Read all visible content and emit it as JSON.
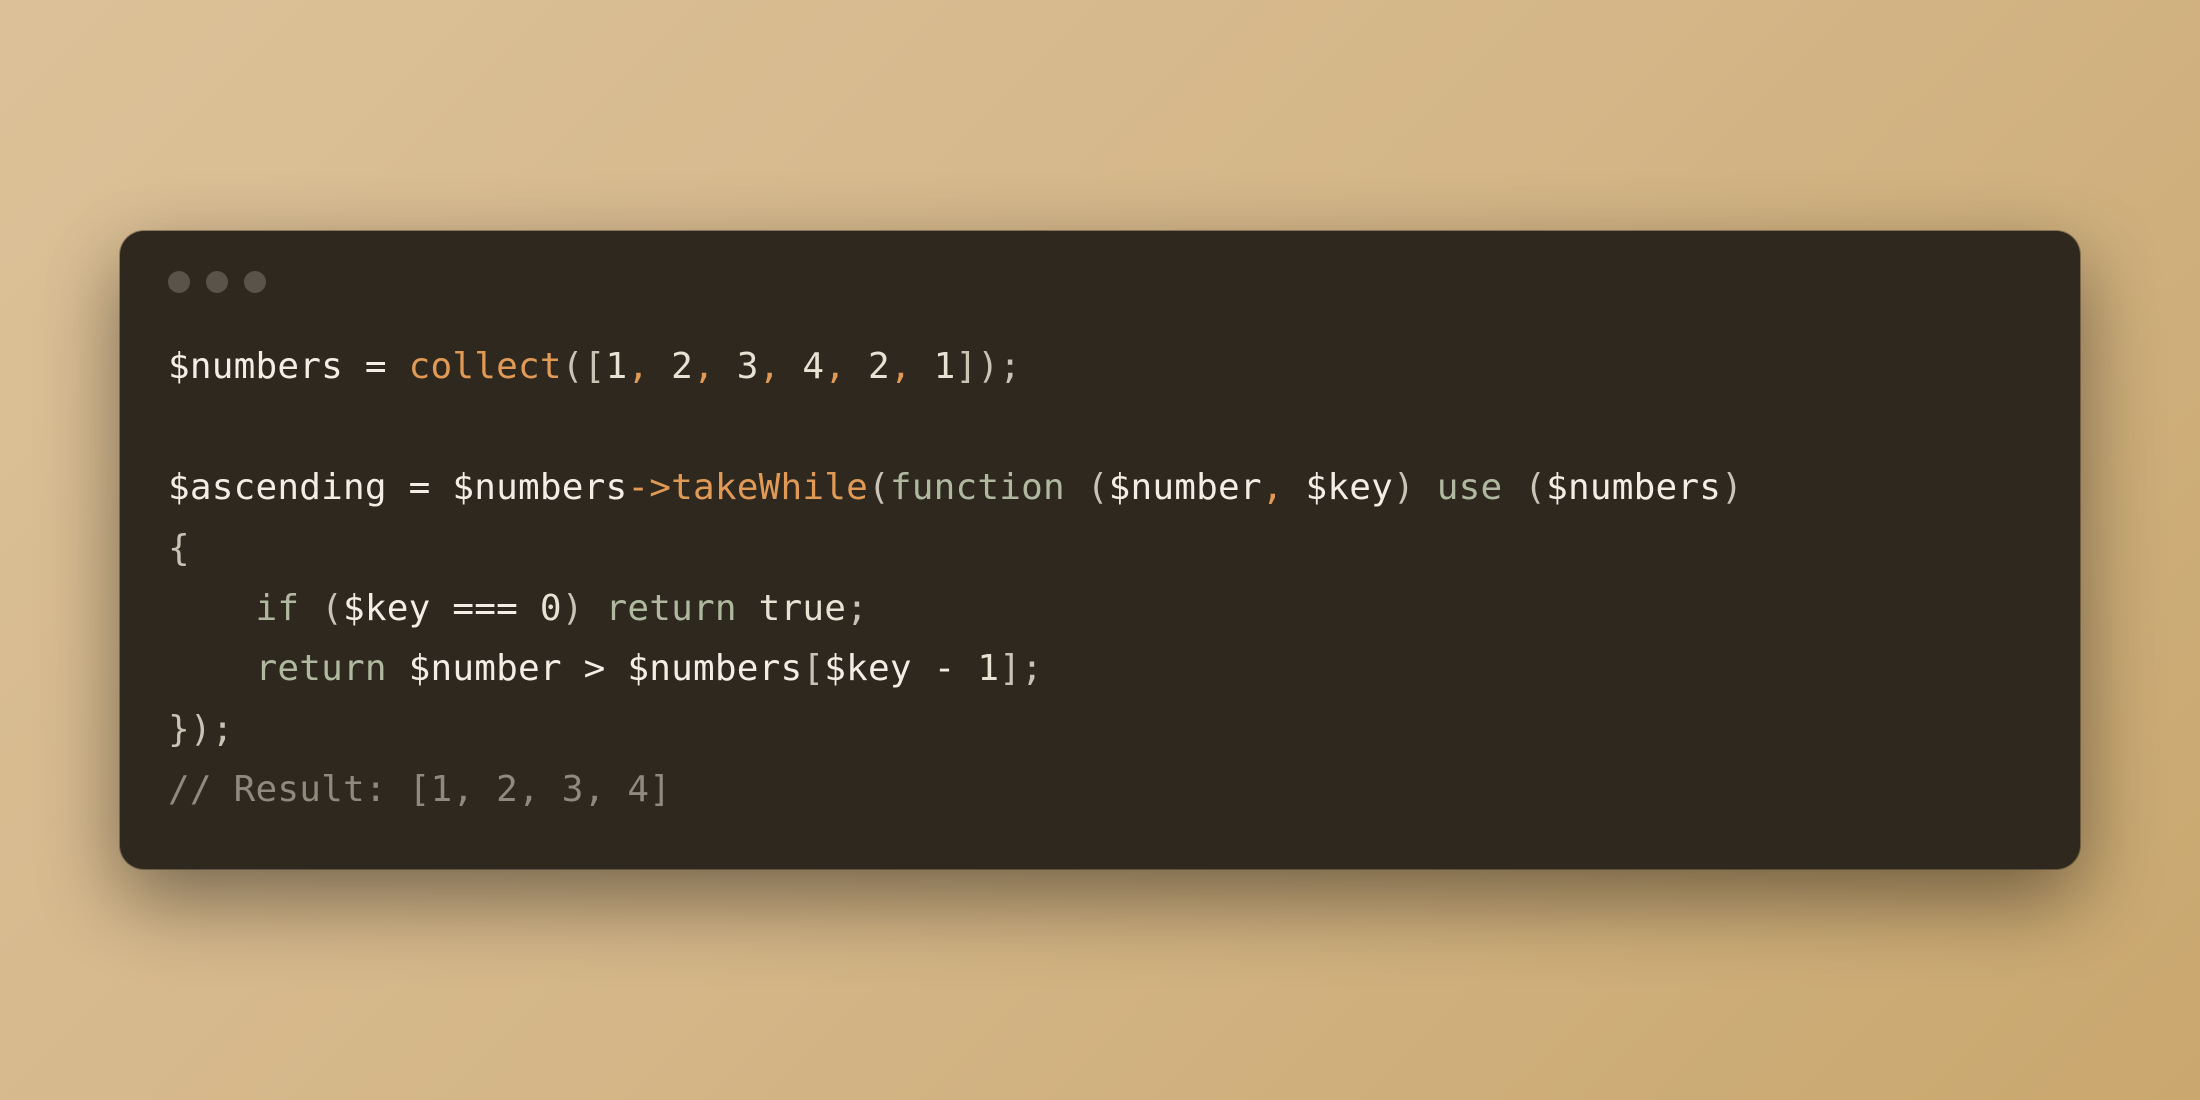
{
  "window_controls": [
    "close",
    "minimize",
    "maximize"
  ],
  "code": {
    "lines": [
      [
        {
          "t": "$numbers",
          "c": "tok-var"
        },
        {
          "t": " ",
          "c": "tok-default"
        },
        {
          "t": "=",
          "c": "tok-op"
        },
        {
          "t": " ",
          "c": "tok-default"
        },
        {
          "t": "collect",
          "c": "tok-func"
        },
        {
          "t": "(",
          "c": "tok-punc"
        },
        {
          "t": "[",
          "c": "tok-punc"
        },
        {
          "t": "1",
          "c": "tok-num"
        },
        {
          "t": ",",
          "c": "tok-comma"
        },
        {
          "t": " ",
          "c": "tok-default"
        },
        {
          "t": "2",
          "c": "tok-num"
        },
        {
          "t": ",",
          "c": "tok-comma"
        },
        {
          "t": " ",
          "c": "tok-default"
        },
        {
          "t": "3",
          "c": "tok-num"
        },
        {
          "t": ",",
          "c": "tok-comma"
        },
        {
          "t": " ",
          "c": "tok-default"
        },
        {
          "t": "4",
          "c": "tok-num"
        },
        {
          "t": ",",
          "c": "tok-comma"
        },
        {
          "t": " ",
          "c": "tok-default"
        },
        {
          "t": "2",
          "c": "tok-num"
        },
        {
          "t": ",",
          "c": "tok-comma"
        },
        {
          "t": " ",
          "c": "tok-default"
        },
        {
          "t": "1",
          "c": "tok-num"
        },
        {
          "t": "]",
          "c": "tok-punc"
        },
        {
          "t": ")",
          "c": "tok-punc"
        },
        {
          "t": ";",
          "c": "tok-punc"
        }
      ],
      [],
      [
        {
          "t": "$ascending",
          "c": "tok-var"
        },
        {
          "t": " ",
          "c": "tok-default"
        },
        {
          "t": "=",
          "c": "tok-op"
        },
        {
          "t": " ",
          "c": "tok-default"
        },
        {
          "t": "$numbers",
          "c": "tok-var"
        },
        {
          "t": "->",
          "c": "tok-func"
        },
        {
          "t": "takeWhile",
          "c": "tok-func"
        },
        {
          "t": "(",
          "c": "tok-punc"
        },
        {
          "t": "function",
          "c": "tok-keyword"
        },
        {
          "t": " ",
          "c": "tok-default"
        },
        {
          "t": "(",
          "c": "tok-punc"
        },
        {
          "t": "$number",
          "c": "tok-var"
        },
        {
          "t": ",",
          "c": "tok-comma"
        },
        {
          "t": " ",
          "c": "tok-default"
        },
        {
          "t": "$key",
          "c": "tok-var"
        },
        {
          "t": ")",
          "c": "tok-punc"
        },
        {
          "t": " ",
          "c": "tok-default"
        },
        {
          "t": "use",
          "c": "tok-keyword"
        },
        {
          "t": " ",
          "c": "tok-default"
        },
        {
          "t": "(",
          "c": "tok-punc"
        },
        {
          "t": "$numbers",
          "c": "tok-var"
        },
        {
          "t": ")",
          "c": "tok-punc"
        }
      ],
      [
        {
          "t": "{",
          "c": "tok-punc"
        }
      ],
      [
        {
          "t": "    ",
          "c": "tok-default"
        },
        {
          "t": "if",
          "c": "tok-keyword"
        },
        {
          "t": " ",
          "c": "tok-default"
        },
        {
          "t": "(",
          "c": "tok-punc"
        },
        {
          "t": "$key",
          "c": "tok-var"
        },
        {
          "t": " ",
          "c": "tok-default"
        },
        {
          "t": "===",
          "c": "tok-op"
        },
        {
          "t": " ",
          "c": "tok-default"
        },
        {
          "t": "0",
          "c": "tok-num"
        },
        {
          "t": ")",
          "c": "tok-punc"
        },
        {
          "t": " ",
          "c": "tok-default"
        },
        {
          "t": "return",
          "c": "tok-keyword"
        },
        {
          "t": " ",
          "c": "tok-default"
        },
        {
          "t": "true",
          "c": "tok-bool"
        },
        {
          "t": ";",
          "c": "tok-punc"
        }
      ],
      [
        {
          "t": "    ",
          "c": "tok-default"
        },
        {
          "t": "return",
          "c": "tok-keyword"
        },
        {
          "t": " ",
          "c": "tok-default"
        },
        {
          "t": "$number",
          "c": "tok-var"
        },
        {
          "t": " ",
          "c": "tok-default"
        },
        {
          "t": ">",
          "c": "tok-op"
        },
        {
          "t": " ",
          "c": "tok-default"
        },
        {
          "t": "$numbers",
          "c": "tok-var"
        },
        {
          "t": "[",
          "c": "tok-punc"
        },
        {
          "t": "$key",
          "c": "tok-var"
        },
        {
          "t": " ",
          "c": "tok-default"
        },
        {
          "t": "-",
          "c": "tok-op"
        },
        {
          "t": " ",
          "c": "tok-default"
        },
        {
          "t": "1",
          "c": "tok-num"
        },
        {
          "t": "]",
          "c": "tok-punc"
        },
        {
          "t": ";",
          "c": "tok-punc"
        }
      ],
      [
        {
          "t": "}",
          "c": "tok-punc"
        },
        {
          "t": ")",
          "c": "tok-punc"
        },
        {
          "t": ";",
          "c": "tok-punc"
        }
      ],
      [
        {
          "t": "// Result: [1, 2, 3, 4]",
          "c": "tok-comment"
        }
      ]
    ]
  }
}
